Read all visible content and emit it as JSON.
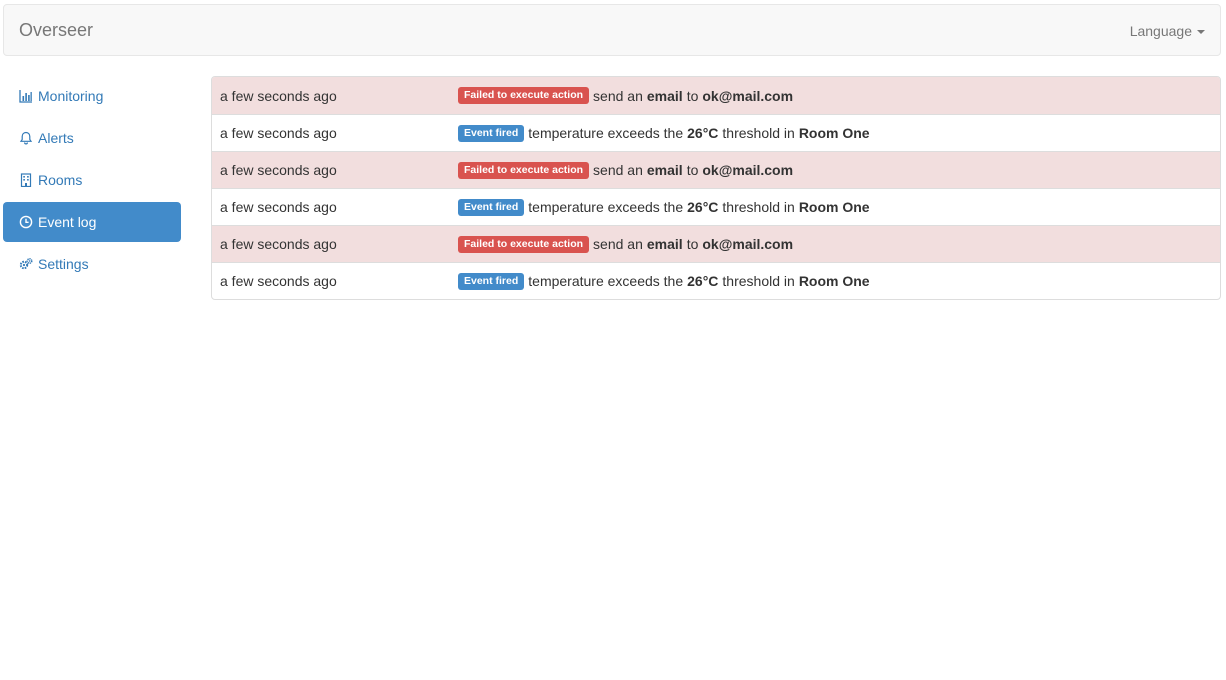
{
  "navbar": {
    "brand": "Overseer",
    "language_label": "Language"
  },
  "sidebar": {
    "items": [
      {
        "label": "Monitoring",
        "icon": "bar-chart-icon"
      },
      {
        "label": "Alerts",
        "icon": "bell-icon"
      },
      {
        "label": "Rooms",
        "icon": "building-icon"
      },
      {
        "label": "Event log",
        "icon": "clock-icon",
        "active": true
      },
      {
        "label": "Settings",
        "icon": "gears-icon"
      }
    ]
  },
  "event_log": {
    "rows": [
      {
        "time": "a few seconds ago",
        "badge": "Failed to execute action",
        "p1": "send an",
        "b1": "email",
        "p2": "to",
        "b2": "ok@mail.com"
      },
      {
        "time": "a few seconds ago",
        "badge": "Event fired",
        "p1": "temperature exceeds the",
        "b1": "26°C",
        "p2": "threshold in",
        "b2": "Room One"
      },
      {
        "time": "a few seconds ago",
        "badge": "Failed to execute action",
        "p1": "send an",
        "b1": "email",
        "p2": "to",
        "b2": "ok@mail.com"
      },
      {
        "time": "a few seconds ago",
        "badge": "Event fired",
        "p1": "temperature exceeds the",
        "b1": "26°C",
        "p2": "threshold in",
        "b2": "Room One"
      },
      {
        "time": "a few seconds ago",
        "badge": "Failed to execute action",
        "p1": "send an",
        "b1": "email",
        "p2": "to",
        "b2": "ok@mail.com"
      },
      {
        "time": "a few seconds ago",
        "badge": "Event fired",
        "p1": "temperature exceeds the",
        "b1": "26°C",
        "p2": "threshold in",
        "b2": "Room One"
      }
    ]
  },
  "colors": {
    "danger_row": "#f2dede",
    "danger_badge": "#d9534f",
    "primary": "#428bca",
    "link": "#337ab7"
  }
}
